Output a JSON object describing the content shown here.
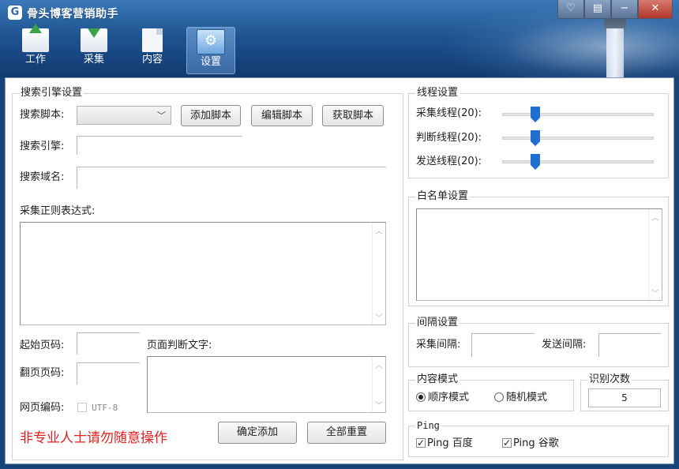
{
  "app": {
    "icon_glyph": "G",
    "title": "骨头博客营销助手"
  },
  "window_buttons": {
    "skin": "♡",
    "menu": "▤",
    "minimize": "−",
    "close": "✕"
  },
  "nav": {
    "tabs": [
      {
        "label": "工作",
        "icon": "upload-arrow-icon"
      },
      {
        "label": "采集",
        "icon": "download-arrow-icon"
      },
      {
        "label": "内容",
        "icon": "document-icon"
      },
      {
        "label": "设置",
        "icon": "settings-icon",
        "active": true
      }
    ]
  },
  "search_engine": {
    "group_title": "搜索引擎设置",
    "script_label": "搜索脚本:",
    "script_value": "",
    "add_script": "添加脚本",
    "edit_script": "编辑脚本",
    "get_script": "获取脚本",
    "engine_label": "搜索引擎:",
    "engine_value": "",
    "domain_label": "搜索域名:",
    "domain_value": "",
    "regex_label": "采集正则表达式:",
    "regex_value": "",
    "start_page_label": "起始页码:",
    "start_page_value": "",
    "next_page_label": "翻页页码:",
    "next_page_value": "",
    "page_judge_label": "页面判断文字:",
    "page_judge_value": "",
    "encoding_label": "网页编码:",
    "encoding_option": "UTF-8",
    "warning": "非专业人士请勿随意操作",
    "confirm_add": "确定添加",
    "reset_all": "全部重置"
  },
  "threads": {
    "group_title": "线程设置",
    "items": [
      {
        "label": "采集线程(20):",
        "value": 20,
        "max": 100
      },
      {
        "label": "判断线程(20):",
        "value": 20,
        "max": 100
      },
      {
        "label": "发送线程(20):",
        "value": 20,
        "max": 100
      }
    ]
  },
  "whitelist": {
    "group_title": "白名单设置",
    "value": ""
  },
  "interval": {
    "group_title": "间隔设置",
    "collect_label": "采集间隔:",
    "collect_value": "",
    "send_label": "发送间隔:",
    "send_value": ""
  },
  "content_mode": {
    "group_title": "内容模式",
    "sequential": "顺序模式",
    "random": "随机模式",
    "selected": "sequential"
  },
  "recognize": {
    "group_title": "识别次数",
    "value": "5"
  },
  "ping": {
    "group_title": "Ping",
    "baidu": "Ping 百度",
    "google": "Ping 谷歌",
    "baidu_checked": true,
    "google_checked": true
  },
  "colors": {
    "title_bar": "#1f5592",
    "warning_text": "#e02020",
    "slider_thumb": "#1e6fd0"
  }
}
